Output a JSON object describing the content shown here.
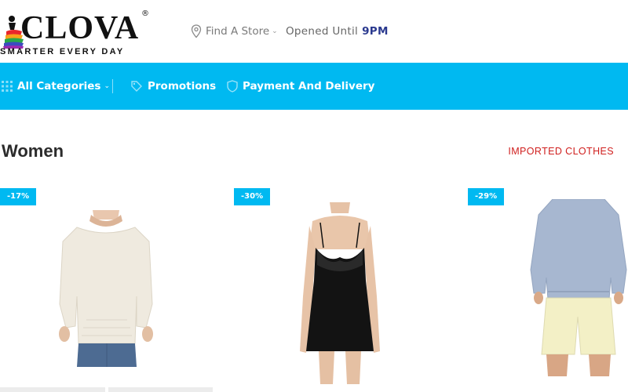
{
  "header": {
    "logo_name": "CLOVA",
    "logo_reg": "®",
    "logo_tagline": "SMARTER EVERY DAY",
    "store_label": "Find A Store",
    "opened_label": "Opened Until",
    "opened_time": "9PM"
  },
  "nav": {
    "items": [
      {
        "label": "All Categories",
        "icon": "grid-icon"
      },
      {
        "label": "Promotions",
        "icon": "tag-icon"
      },
      {
        "label": "Payment And Delivery",
        "icon": "shield-icon"
      }
    ]
  },
  "section": {
    "title": "Women",
    "link": "IMPORTED CLOTHES"
  },
  "products": [
    {
      "discount": "-17%",
      "image": "beige-long-sleeve-top"
    },
    {
      "discount": "-30%",
      "image": "black-lace-chemise"
    },
    {
      "discount": "-29%",
      "image": "blue-sweatshirt-and-shorts"
    }
  ],
  "colors": {
    "accent": "#00b9f1",
    "link_red": "#d0201f",
    "time_blue": "#2b3a8f"
  }
}
